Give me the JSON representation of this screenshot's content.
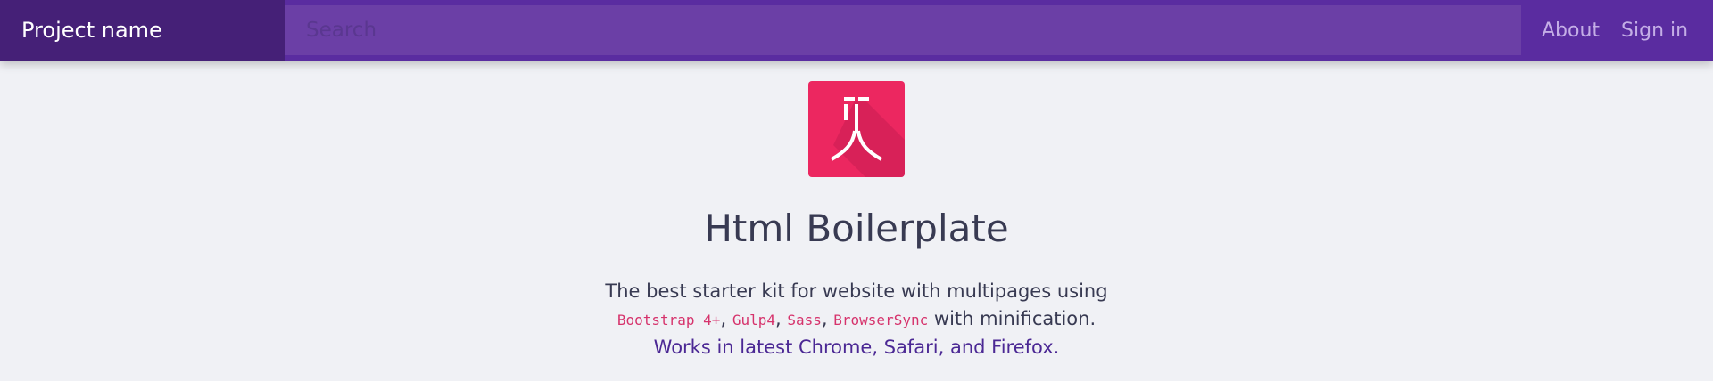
{
  "navbar": {
    "brand": "Project name",
    "search_placeholder": "Search",
    "links": [
      "About",
      "Sign in"
    ]
  },
  "hero": {
    "logo_icon": "boilerplate-logo-icon",
    "title": "Html Boilerplate",
    "lead_line1": "The best starter kit for website with multipages using",
    "tech": [
      "Bootstrap 4+",
      "Gulp4",
      "Sass",
      "BrowserSync"
    ],
    "separator": ",",
    "lead_line2_suffix": "with minification.",
    "lead_line3": "Works in latest Chrome, Safari, and Firefox."
  },
  "colors": {
    "navbar_bg": "#5a2ca0",
    "brand_bg": "#452077",
    "search_bg": "#6b3fa6",
    "logo_bg": "#ec2760",
    "code_text": "#d6336c",
    "accent_text": "#4b2894",
    "page_bg": "#f0f1f5"
  }
}
